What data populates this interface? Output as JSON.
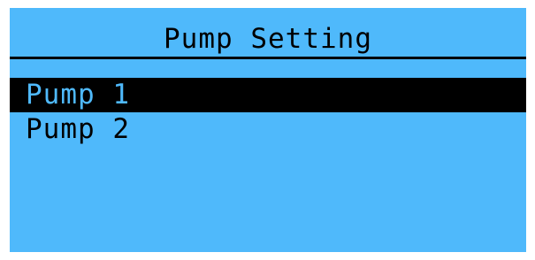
{
  "screen": {
    "title": "Pump Setting",
    "background_color": "#4fb9fb",
    "foreground_color": "#000000"
  },
  "menu": {
    "items": [
      {
        "label": "Pump 1",
        "selected": true
      },
      {
        "label": "Pump 2",
        "selected": false
      }
    ]
  }
}
